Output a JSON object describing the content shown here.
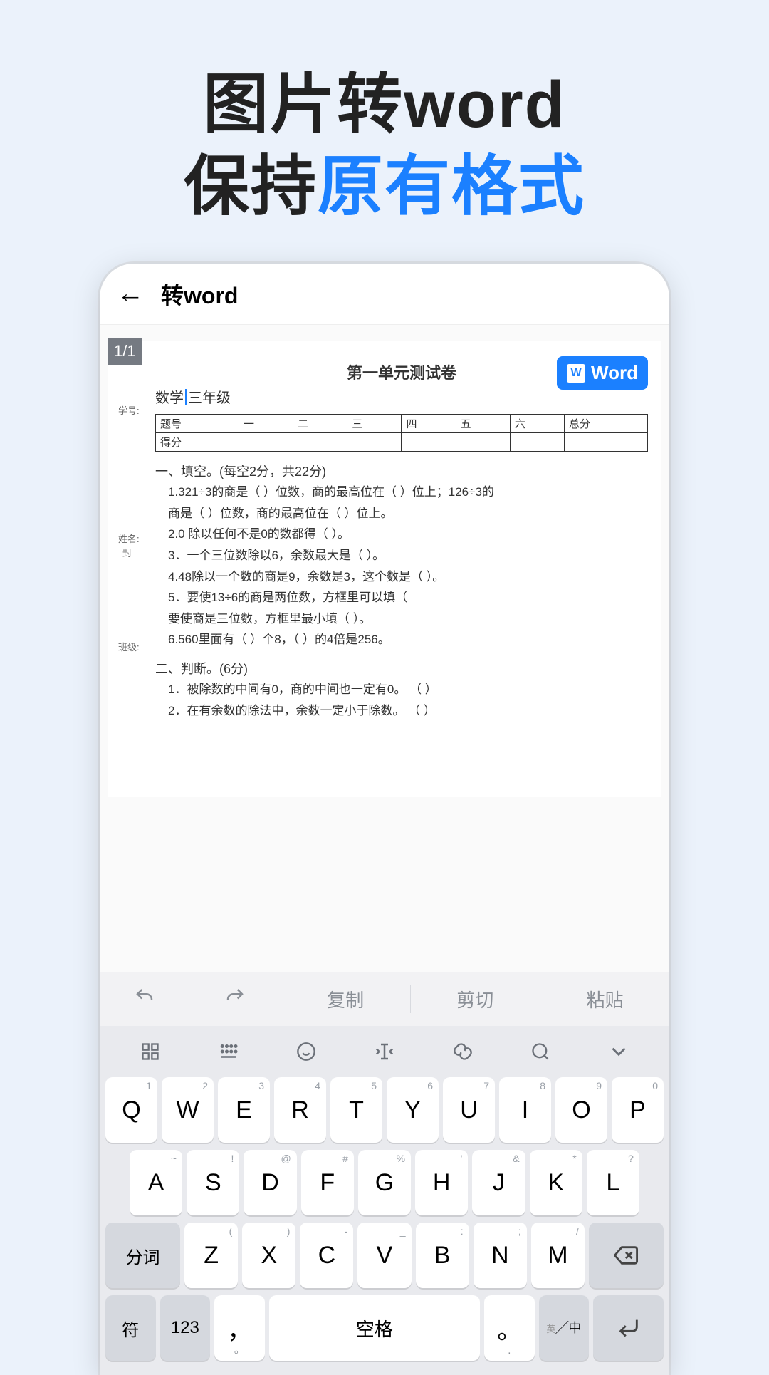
{
  "marketing": {
    "line1": "图片转word",
    "line2a": "保持",
    "line2b": "原有格式"
  },
  "app_bar": {
    "title": "转word"
  },
  "doc": {
    "page_indicator": "1/1",
    "word_badge": "Word",
    "title": "第一单元测试卷",
    "subject_prefix": "数学",
    "subject_suffix": "三年级",
    "side_labels": {
      "s1": "学号:",
      "s2": "姓名:",
      "s3": "封",
      "s4": "班级:"
    },
    "table": {
      "r1": [
        "题号",
        "一",
        "二",
        "三",
        "四",
        "五",
        "六",
        "总分"
      ],
      "r2": [
        "得分",
        "",
        "",
        "",
        "",
        "",
        "",
        ""
      ]
    },
    "section1": "一、填空。(每空2分，共22分)",
    "q1a": "1.321÷3的商是（  ）位数，商的最高位在（ ）位上；126÷3的",
    "q1b": "商是（  ）位数，商的最高位在（ ）位上。",
    "q2": "2.0 除以任何不是0的数都得（  ）。",
    "q3": "3．一个三位数除以6，余数最大是（  ）。",
    "q4": "4.48除以一个数的商是9，余数是3，这个数是（  ）。",
    "q5a": "5．要使13÷6的商是两位数，方框里可以填（",
    "q5b": "要使商是三位数，方框里最小填（  ）。",
    "q6": "6.560里面有（  ）个8，（  ）的4倍是256。",
    "section2": "二、判断。(6分)",
    "j1": "1．被除数的中间有0，商的中间也一定有0。   （                                 ）",
    "j2": "2．在有余数的除法中，余数一定小于除数。   （  ）"
  },
  "edit_toolbar": {
    "copy": "复制",
    "cut": "剪切",
    "paste": "粘贴"
  },
  "keyboard": {
    "row1": [
      {
        "main": "Q",
        "hint": "1"
      },
      {
        "main": "W",
        "hint": "2"
      },
      {
        "main": "E",
        "hint": "3"
      },
      {
        "main": "R",
        "hint": "4"
      },
      {
        "main": "T",
        "hint": "5"
      },
      {
        "main": "Y",
        "hint": "6"
      },
      {
        "main": "U",
        "hint": "7"
      },
      {
        "main": "I",
        "hint": "8"
      },
      {
        "main": "O",
        "hint": "9"
      },
      {
        "main": "P",
        "hint": "0"
      }
    ],
    "row2": [
      {
        "main": "A",
        "hint": "~"
      },
      {
        "main": "S",
        "hint": "!"
      },
      {
        "main": "D",
        "hint": "@"
      },
      {
        "main": "F",
        "hint": "#"
      },
      {
        "main": "G",
        "hint": "%"
      },
      {
        "main": "H",
        "hint": "'"
      },
      {
        "main": "J",
        "hint": "&"
      },
      {
        "main": "K",
        "hint": "*"
      },
      {
        "main": "L",
        "hint": "?"
      }
    ],
    "row3_fn1": "分词",
    "row3": [
      {
        "main": "Z",
        "hint": "("
      },
      {
        "main": "X",
        "hint": ")"
      },
      {
        "main": "C",
        "hint": "-"
      },
      {
        "main": "V",
        "hint": "_"
      },
      {
        "main": "B",
        "hint": ":"
      },
      {
        "main": "N",
        "hint": ";"
      },
      {
        "main": "M",
        "hint": "/"
      }
    ],
    "row4": {
      "sym": "符",
      "num": "123",
      "comma": "，",
      "comma_sub": "。",
      "space": "空格",
      "period": "。",
      "period_sub": ".",
      "lang_top": "英",
      "lang_bottom": "中"
    }
  }
}
